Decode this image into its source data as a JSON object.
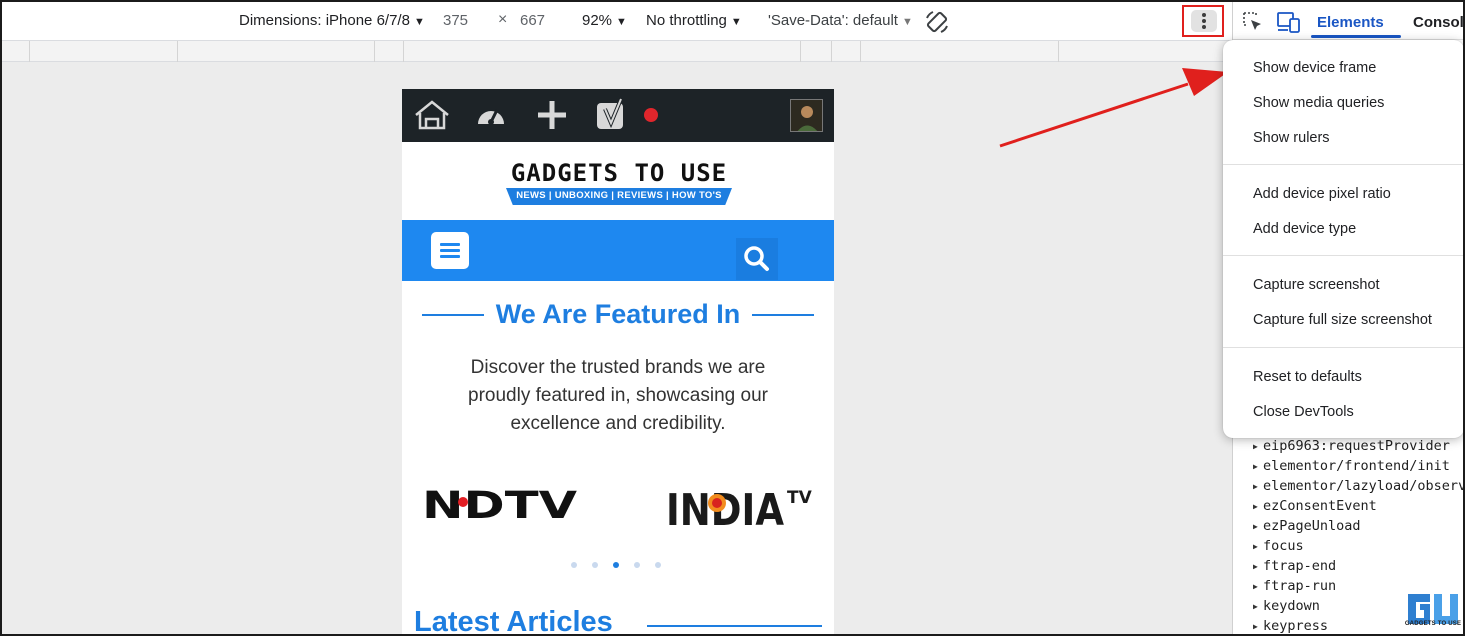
{
  "toolbar": {
    "dimensions_label": "Dimensions: iPhone 6/7/8",
    "width": "375",
    "times": "×",
    "height": "667",
    "zoom": "92%",
    "throttling": "No throttling",
    "save_data": "'Save-Data': default",
    "caret": "▼"
  },
  "devtools": {
    "tab_elements": "Elements",
    "tab_console": "Console",
    "events": [
      "eip6963:requestProvider",
      "elementor/frontend/init",
      "elementor/lazyload/observ",
      "ezConsentEvent",
      "ezPageUnload",
      "focus",
      "ftrap-end",
      "ftrap-run",
      "keydown",
      "keypress"
    ]
  },
  "menu": {
    "items": [
      "Show device frame",
      "Show media queries",
      "Show rulers",
      "Add device pixel ratio",
      "Add device type",
      "Capture screenshot",
      "Capture full size screenshot",
      "Reset to defaults",
      "Close DevTools"
    ]
  },
  "phone": {
    "logo_main": "GADGETS TO USE",
    "logo_tagline": "NEWS | UNBOXING | REVIEWS | HOW TO'S",
    "featured_title": "We Are Featured In",
    "featured_desc": "Discover the trusted brands we are proudly featured in, showcasing our excellence and credibility.",
    "brand_ndtv": "NDTV",
    "brand_india": "INDIA",
    "brand_tv": "TV",
    "carousel_active_index": 2,
    "carousel_count": 5,
    "latest_title": "Latest Articles"
  },
  "watermark": {
    "text": "GADGETS TO USE"
  },
  "colors": {
    "accent_blue": "#1e7ee0",
    "highlight_red": "#e0201d",
    "devtools_blue": "#1a56c4"
  }
}
